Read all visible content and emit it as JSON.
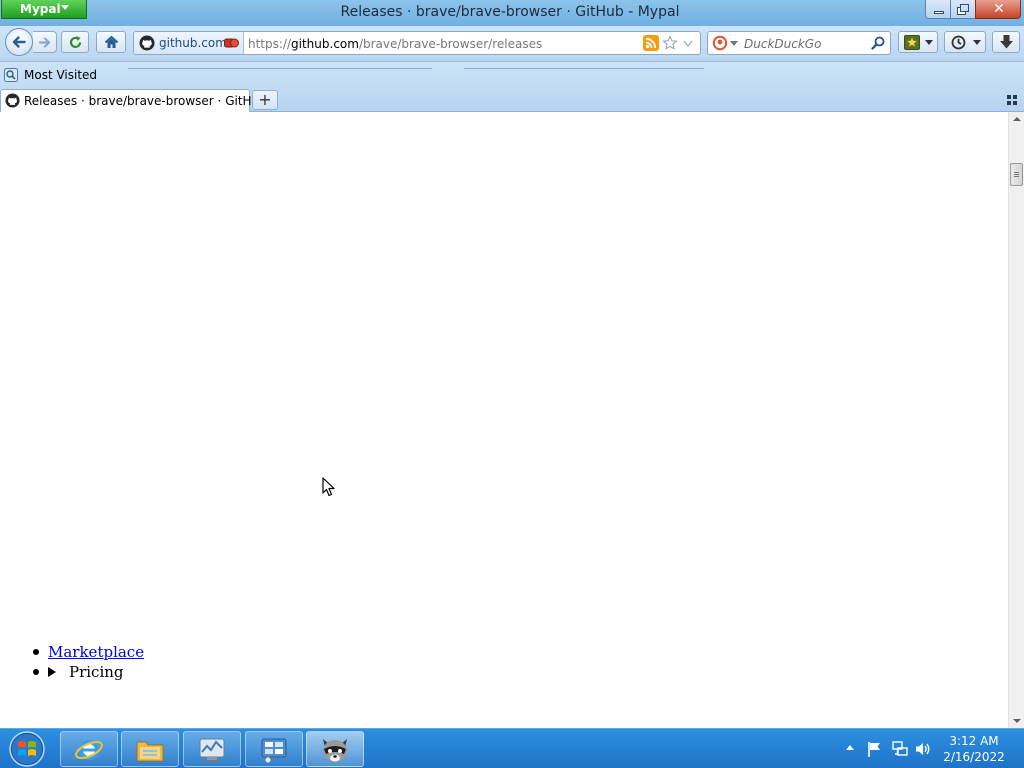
{
  "window": {
    "app_menu_label": "Mypal",
    "title": "Releases · brave/brave-browser · GitHub - Mypal",
    "close_glyph": "✕"
  },
  "navbar": {
    "identity_label": "github.com",
    "url_prefix": "https://",
    "url_host": "github.com",
    "url_path": "/brave/brave-browser/releases",
    "search_placeholder": "DuckDuckGo"
  },
  "bookmarks": {
    "items": [
      {
        "label": "Most Visited",
        "icon": "bookmarks-folder-icon"
      }
    ]
  },
  "tabs": {
    "items": [
      {
        "label": "Releases · brave/brave-browser · GitHub",
        "icon": "github-icon",
        "active": true
      }
    ],
    "new_tab_label": "+"
  },
  "page": {
    "nav_items": [
      {
        "label": "Marketplace",
        "type": "link"
      },
      {
        "label": "Pricing",
        "type": "summary"
      }
    ]
  },
  "taskbar": {
    "pinned": [
      {
        "name": "internet-explorer-icon",
        "active": false
      },
      {
        "name": "file-explorer-icon",
        "active": false
      },
      {
        "name": "resource-monitor-icon",
        "active": false
      },
      {
        "name": "control-panel-icon",
        "active": false
      },
      {
        "name": "mypal-raccoon-icon",
        "active": true
      }
    ],
    "clock_time": "3:12 AM",
    "clock_date": "2/16/2022"
  },
  "colors": {
    "titlebar": "#8dc3ea",
    "app_menu": "#2eb02e",
    "close_button": "#c7432a",
    "link": "#0000ee",
    "taskbar": "#2381d6"
  }
}
